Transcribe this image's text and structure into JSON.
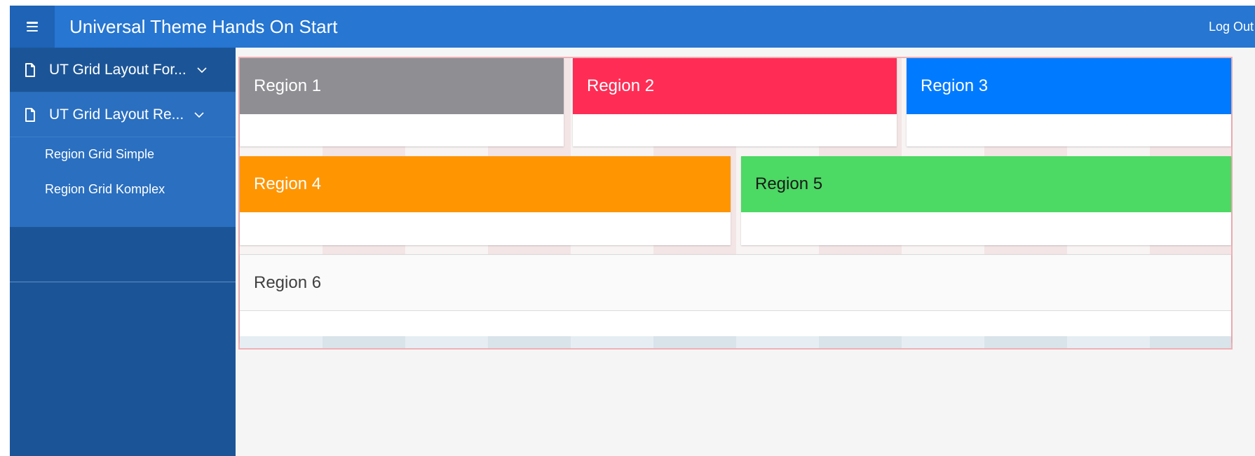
{
  "header": {
    "menu_icon": "hamburger-menu-icon",
    "title": "Universal Theme Hands On Start",
    "logout_label": "Log Out"
  },
  "sidebar": {
    "items": [
      {
        "label": "UT Grid Layout For...",
        "icon": "document-icon",
        "expand_icon": "chevron-down-icon"
      },
      {
        "label": "UT Grid Layout Re...",
        "icon": "document-icon",
        "expand_icon": "chevron-down-icon"
      }
    ],
    "sub_items": [
      {
        "label": "Region Grid Simple"
      },
      {
        "label": "Region Grid Komplex"
      }
    ]
  },
  "regions": [
    {
      "title": "Region 1",
      "color": "#8e8e93",
      "text_color": "#ffffff"
    },
    {
      "title": "Region 2",
      "color": "#ff2d55",
      "text_color": "#ffffff"
    },
    {
      "title": "Region 3",
      "color": "#007aff",
      "text_color": "#ffffff"
    },
    {
      "title": "Region 4",
      "color": "#ff9500",
      "text_color": "#ffffff"
    },
    {
      "title": "Region 5",
      "color": "#4cd964",
      "text_color": "#1a1a1a"
    },
    {
      "title": "Region 6",
      "color": "#fafafa",
      "text_color": "#404040"
    }
  ],
  "colors": {
    "header": "#2676d2",
    "sidebar": "#1c5597",
    "sidebar_active": "#2a6fc0"
  }
}
